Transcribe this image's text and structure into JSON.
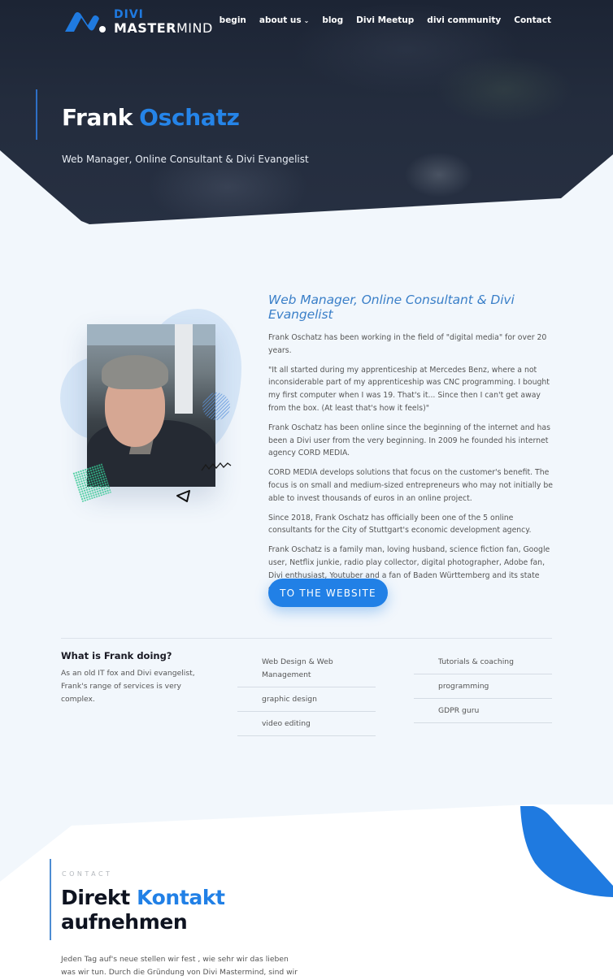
{
  "brand": {
    "logo_top": "DIVI",
    "logo_bottom_bold": "MASTER",
    "logo_bottom_light": "MIND",
    "accent_color": "#2180e6"
  },
  "nav": {
    "items": [
      {
        "label": "begin"
      },
      {
        "label": "about us",
        "has_dropdown": true,
        "icon": "chevron-down-icon"
      },
      {
        "label": "blog"
      },
      {
        "label": "Divi Meetup"
      },
      {
        "label": "divi community"
      },
      {
        "label": "Contact"
      }
    ],
    "caret": "⌄"
  },
  "hero": {
    "title_first": "Frank",
    "title_last": "Oschatz",
    "subtitle": "Web Manager, Online Consultant & Divi Evangelist"
  },
  "about": {
    "heading": "Web Manager, Online Consultant & Divi Evangelist",
    "paragraphs": [
      "Frank Oschatz has been working in the field of \"digital media\" for over 20 years.",
      "\"It all started during my apprenticeship at Mercedes Benz, where a not inconsiderable part of my apprenticeship was CNC programming. I bought my first computer when I was 19. That's it... Since then I can't get away from the box. (At least that's how it feels)\"",
      "Frank Oschatz has been online since the beginning of the internet and has been a Divi user from the very beginning. In 2009 he founded his internet agency CORD MEDIA.",
      "CORD MEDIA develops solutions that focus on the customer's benefit. The focus is on small and medium-sized entrepreneurs who may not initially be able to invest thousands of euros in an online project.",
      "Since 2018, Frank Oschatz has officially been one of the 5 online consultants for the City of Stuttgart's economic development agency.",
      "Frank Oschatz is a family man, loving husband, science fiction fan, Google user, Netflix junkie, radio play collector, digital photographer, Adobe fan, Divi enthusiast, Youtuber and a fan of Baden Württemberg and its state capital!"
    ],
    "cta_label": "TO THE WEBSITE"
  },
  "services": {
    "title": "What is Frank doing?",
    "description": "As an old IT fox and Divi evangelist, Frank's range of services is very complex.",
    "column1": [
      "Web Design & Web Management",
      "graphic design",
      "video editing"
    ],
    "column2": [
      "Tutorials & coaching",
      "programming",
      "GDPR guru"
    ]
  },
  "contact": {
    "kicker": "CONTACT",
    "title_a": "Direkt",
    "title_b": "Kontakt",
    "title_c": "aufnehmen",
    "text": "Jeden Tag auf's neue stellen wir fest , wie sehr wir das lieben was wir tun. Durch die Gründung von Divi Mastermind, sind wir"
  }
}
